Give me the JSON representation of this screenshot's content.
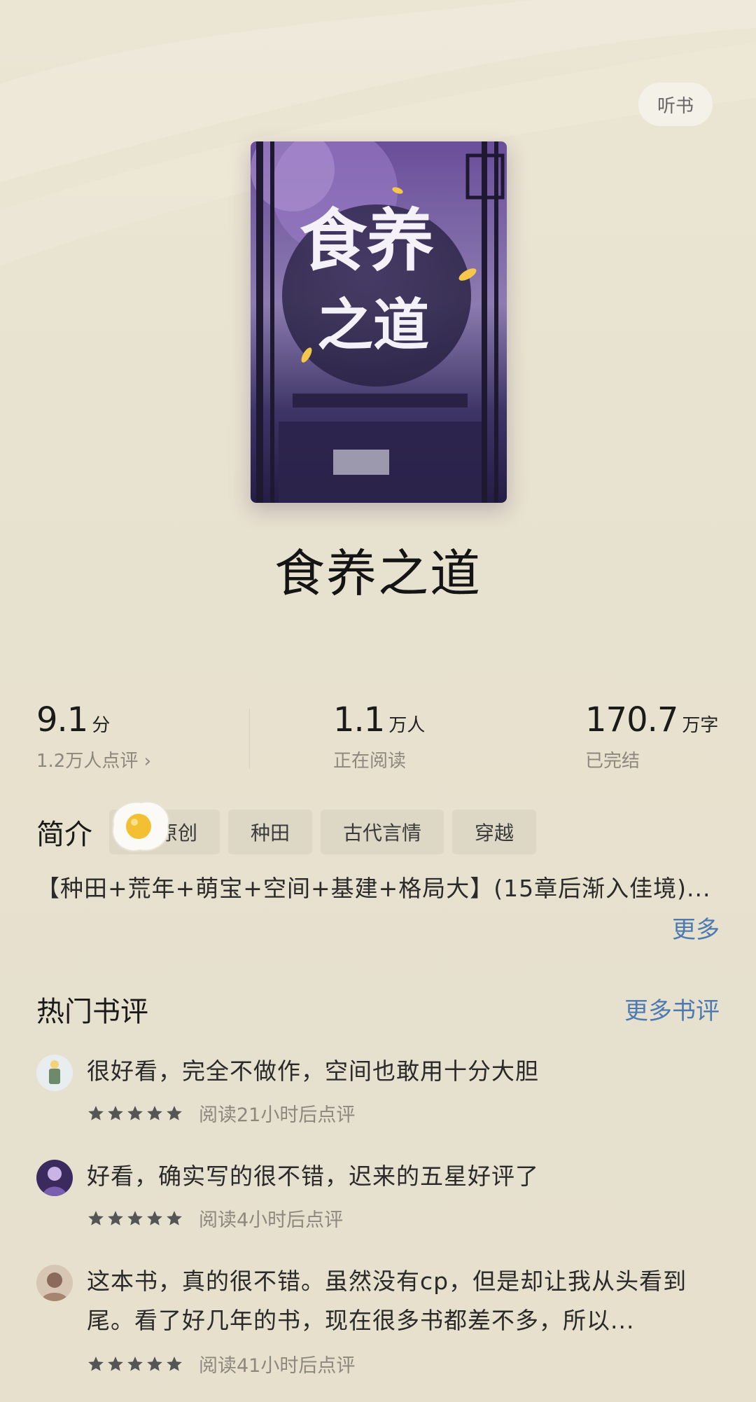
{
  "header": {
    "listen_label": "听书"
  },
  "book": {
    "title": "食养之道",
    "cover_title_line1": "食养",
    "cover_title_line2": "之道"
  },
  "stats": {
    "rating": {
      "value": "9.1",
      "unit": "分",
      "sub": "1.2万人点评 ›"
    },
    "readers": {
      "value": "1.1",
      "unit": "万人",
      "sub": "正在阅读"
    },
    "words": {
      "value": "170.7",
      "unit": "万字",
      "sub": "已完结"
    }
  },
  "intro": {
    "label": "简介",
    "tags": [
      "原创",
      "种田",
      "古代言情",
      "穿越"
    ],
    "text": "【种田+荒年+萌宝+空间+基建+格局大】(15章后渐入佳境)...",
    "more_label": "更多"
  },
  "reviews": {
    "heading": "热门书评",
    "more_label": "更多书评",
    "items": [
      {
        "text": "很好看，完全不做作，空间也敢用十分大胆",
        "rating": 5,
        "meta": "阅读21小时后点评"
      },
      {
        "text": "好看，确实写的很不错，迟来的五星好评了",
        "rating": 5,
        "meta": "阅读4小时后点评"
      },
      {
        "text": "这本书，真的很不错。虽然没有cp，但是却让我从头看到尾。看了好几年的书，现在很多书都差不多，所以...",
        "rating": 5,
        "meta": "阅读41小时后点评"
      }
    ]
  },
  "colors": {
    "background": "#e7e1cf",
    "link": "#4d7ab0",
    "muted": "#8c887e",
    "tag_bg": "#ddd8c6",
    "star": "#555555"
  },
  "icons": [
    "star-icon",
    "avatar-icon",
    "egg-sticker",
    "chevron-right-icon"
  ]
}
